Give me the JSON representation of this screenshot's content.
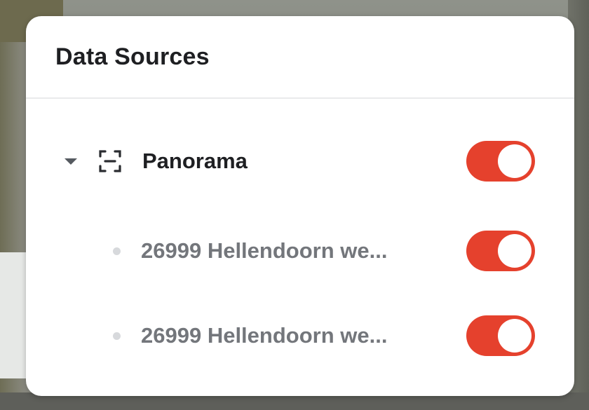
{
  "panel": {
    "title": "Data Sources"
  },
  "sources": {
    "group": {
      "label": "Panorama",
      "icon": "scan-frame-icon",
      "expanded": true,
      "enabled": true
    },
    "items": [
      {
        "label": "26999 Hellendoorn we...",
        "enabled": true
      },
      {
        "label": "26999 Hellendoorn we...",
        "enabled": true
      }
    ]
  },
  "colors": {
    "toggle_on": "#e5412d",
    "title_text": "#1e1f22",
    "item_text": "#73767b"
  }
}
